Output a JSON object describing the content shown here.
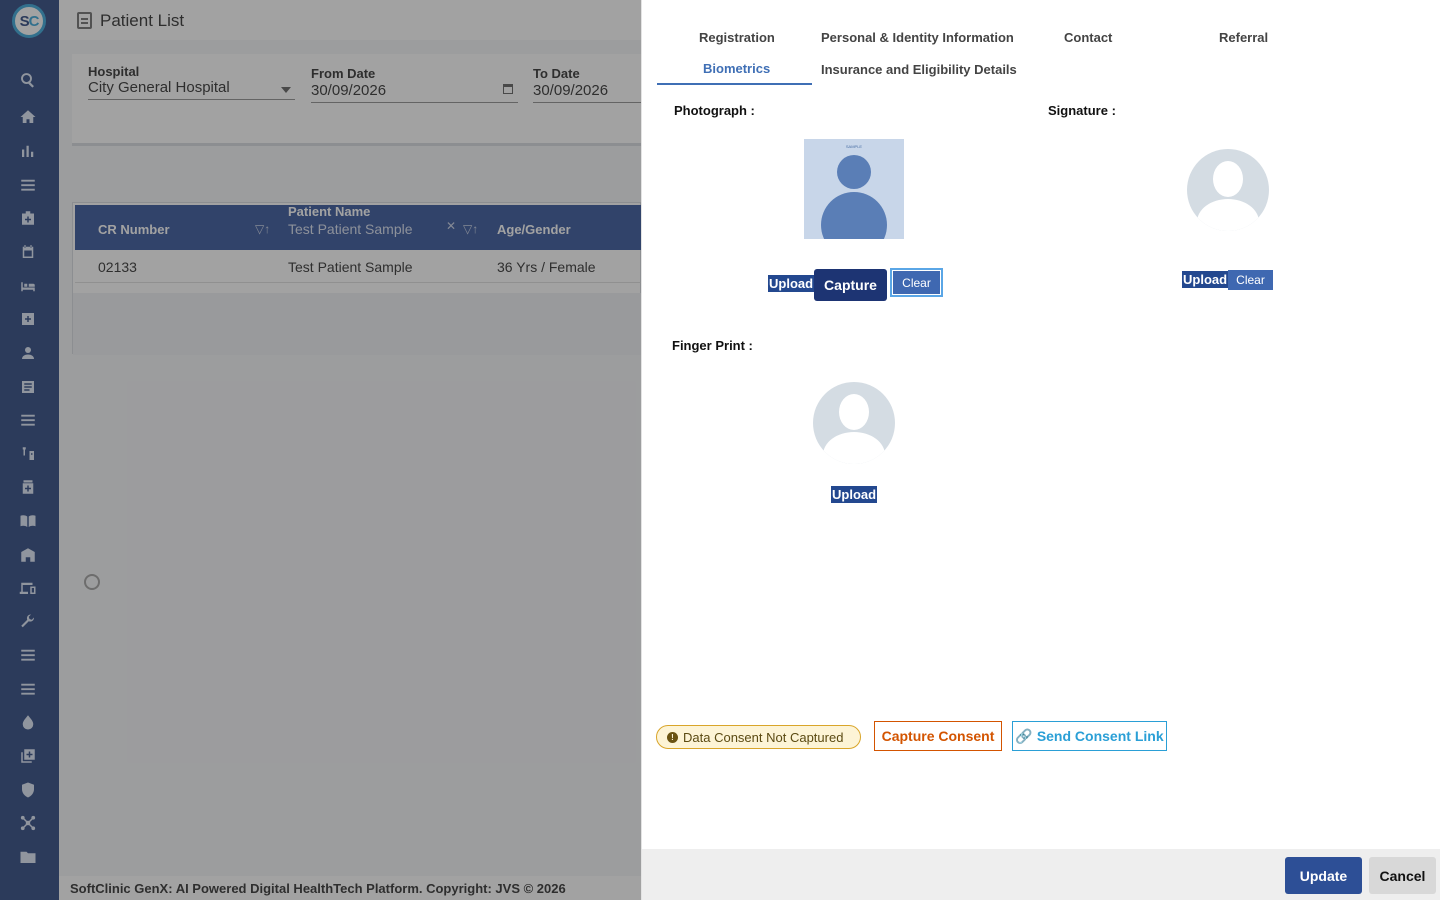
{
  "app": {
    "logo_text": "SC",
    "page_title": "Patient List",
    "footer": "SoftClinic GenX: AI Powered Digital HealthTech Platform. Copyright: JVS © 2026"
  },
  "sidebar": {
    "icons": [
      "search-icon",
      "home-icon",
      "bar-chart-icon",
      "menu-icon",
      "medical-bag-icon",
      "calendar-icon",
      "bed-icon",
      "add-box-icon",
      "person-icon",
      "list-alt-icon",
      "menu-icon",
      "syringe-icon",
      "medicine-icon",
      "book-icon",
      "building-icon",
      "devices-icon",
      "wrench-icon",
      "menu-icon",
      "menu-icon",
      "drop-icon",
      "add-library-icon",
      "shield-icon",
      "network-icon",
      "folder-icon"
    ]
  },
  "filters": {
    "hospital_label": "Hospital",
    "hospital_value": "City General Hospital",
    "from_label": "From Date",
    "from_value": "30/09/2026",
    "to_label": "To Date",
    "to_value": "30/09/2026"
  },
  "table": {
    "columns": [
      "CR Number",
      "Patient Name",
      "Age/Gender"
    ],
    "name_filter_value": "Test Patient Sample",
    "rows": [
      {
        "cr": "02133",
        "name": "Test Patient Sample",
        "age_gender": "36 Yrs / Female"
      }
    ]
  },
  "drawer": {
    "tabs": [
      "Registration",
      "Personal & Identity Information",
      "Contact",
      "Referral",
      "Biometrics",
      "Insurance and Eligibility Details"
    ],
    "active_tab": "Biometrics",
    "photograph_label": "Photograph :",
    "photo_sample_tag": "SAMPLE",
    "signature_label": "Signature :",
    "fingerprint_label": "Finger Print :",
    "upload_label": "Upload",
    "capture_label": "Capture",
    "clear_label": "Clear",
    "consent_status": "Data Consent Not Captured",
    "capture_consent_label": "Capture Consent",
    "send_consent_link_label": "Send Consent Link",
    "update_label": "Update",
    "cancel_label": "Cancel"
  },
  "colors": {
    "sidebar": "#1e3a78",
    "table_header": "#274a94",
    "accent": "#3f6fb5",
    "consent_warning": "#d35400",
    "link": "#2a9fd6"
  }
}
